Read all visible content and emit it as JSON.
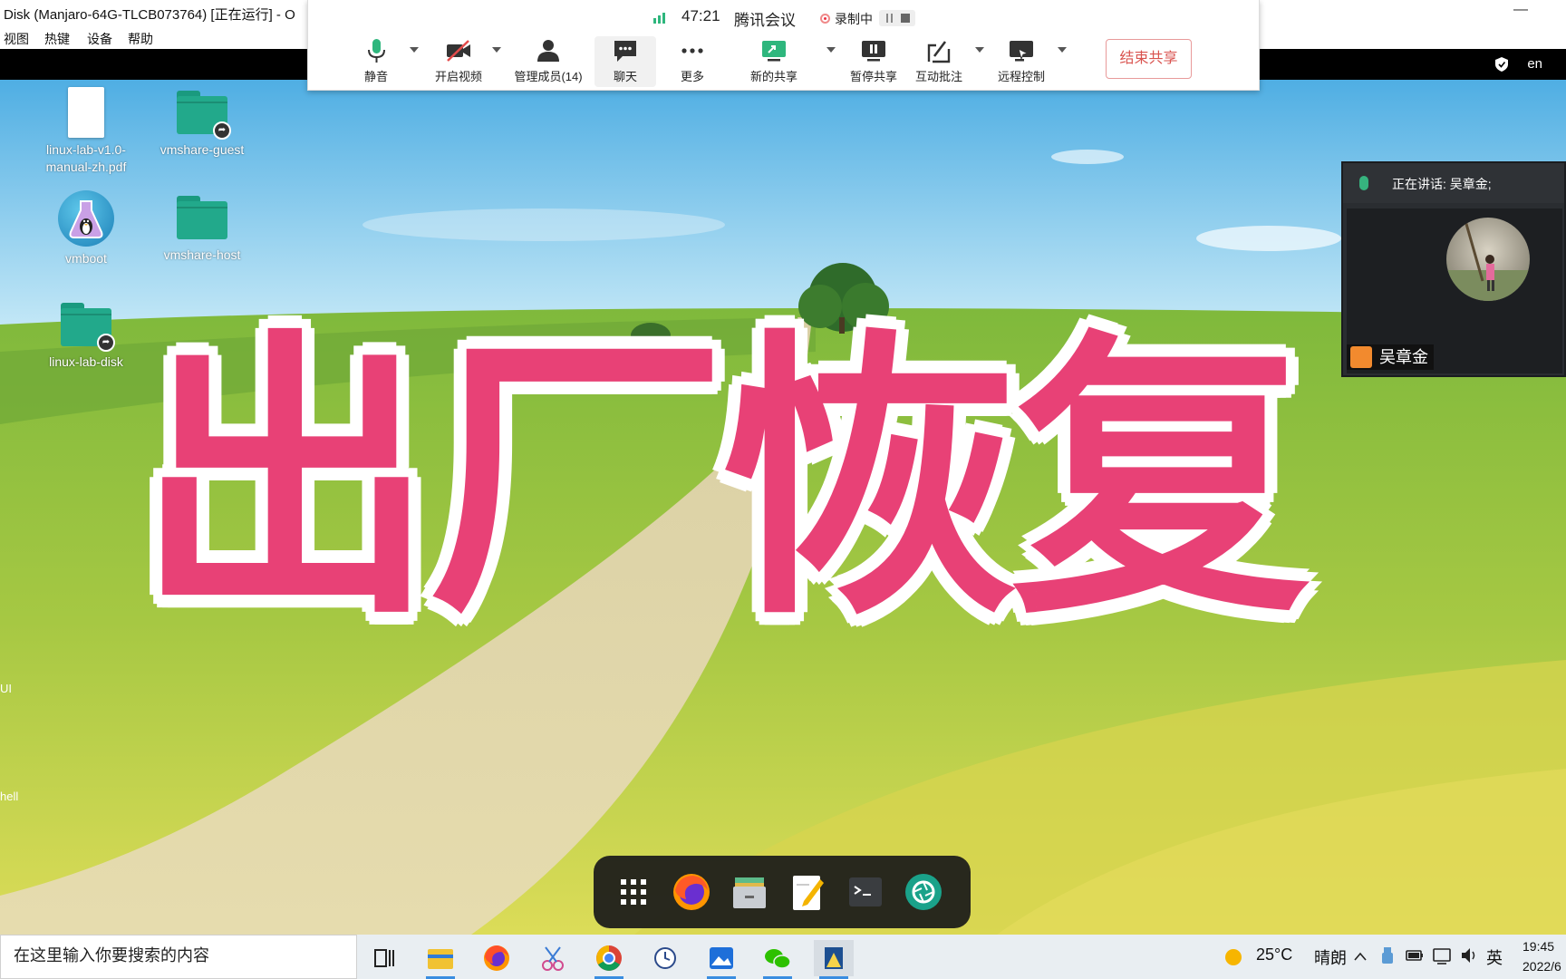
{
  "vm_window": {
    "title": "Disk (Manjaro-64G-TLCB073764) [正在运行] - O",
    "minimize": "—",
    "menu": [
      "视图",
      "热键",
      "设备",
      "帮助"
    ]
  },
  "guest_topbar": {
    "language": "en"
  },
  "meeting": {
    "timer": "47:21",
    "app_name": "腾讯会议",
    "recording_label": "录制中",
    "buttons": {
      "mute": "静音",
      "video": "开启视频",
      "members": "管理成员(14)",
      "chat": "聊天",
      "more": "更多",
      "new_share": "新的共享",
      "pause_share": "暂停共享",
      "annotate": "互动批注",
      "remote_control": "远程控制"
    },
    "end_share": "结束共享"
  },
  "desktop_icons": [
    {
      "name": "linux-lab-v1.0-\nmanual-zh.pdf",
      "type": "pdf"
    },
    {
      "name": "vmshare-guest",
      "type": "folder-shared"
    },
    {
      "name": "vmboot",
      "type": "app"
    },
    {
      "name": "vmshare-host",
      "type": "folder"
    },
    {
      "name": "linux-lab-disk",
      "type": "folder-shared"
    }
  ],
  "left_edge_fragments": [
    "UI",
    "hell"
  ],
  "overlay_title": "出厂恢复",
  "speaker_panel": {
    "speaking_text": "正在讲话: 吴章金;",
    "speaker_name": "吴章金"
  },
  "dock_icons": [
    "apps-grid-icon",
    "firefox-icon",
    "file-manager-icon",
    "text-editor-icon",
    "terminal-icon",
    "screenshot-icon"
  ],
  "taskbar": {
    "search_placeholder": "在这里输入你要搜索的内容",
    "apps": [
      "task-view-icon",
      "file-explorer-icon",
      "firefox-icon",
      "snip-icon",
      "chrome-icon",
      "clock-app-icon",
      "photos-icon",
      "wechat-icon",
      "virtualbox-icon"
    ],
    "weather_temp": "25°C",
    "weather_desc": "晴朗",
    "ime": "英",
    "time": "19:45",
    "date": "2022/6"
  },
  "colors": {
    "title_pink": "#e84176",
    "teal_folder": "#22a98b",
    "end_share_red": "#d9534f",
    "mic_green": "#36b37e"
  }
}
